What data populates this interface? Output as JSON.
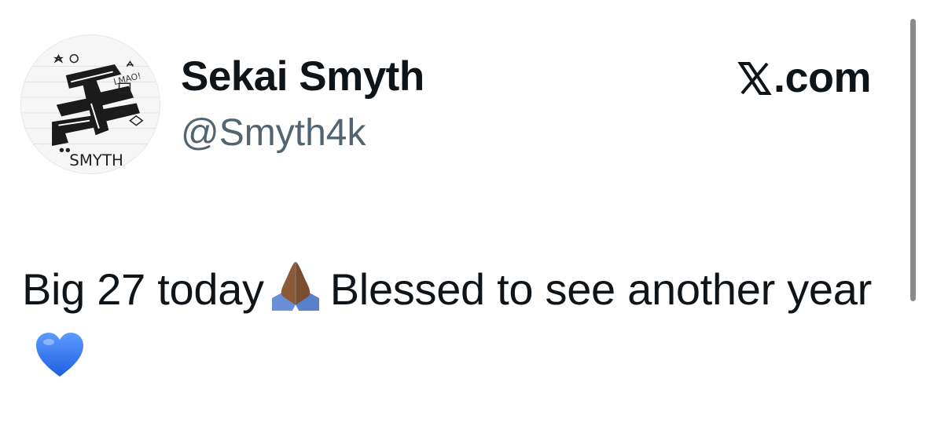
{
  "author": {
    "display_name": "Sekai Smyth",
    "handle": "@Smyth4k",
    "avatar_icon": "sketch-art-avatar",
    "avatar_signature": "SMYTH"
  },
  "brand": {
    "icon": "x-logo-icon",
    "domain": ".com"
  },
  "tweet": {
    "text_part1": "Big 27 today",
    "emoji1": "praying-hands-icon",
    "text_part2": "Blessed to see another year",
    "emoji2": "blue-heart-icon"
  },
  "colors": {
    "name": "#0f1419",
    "handle": "#536471",
    "heart": "#2b6ff2",
    "skin": "#8a5a3b",
    "sleeve": "#6b8fd6",
    "scrollbar": "#8a8a8a"
  }
}
